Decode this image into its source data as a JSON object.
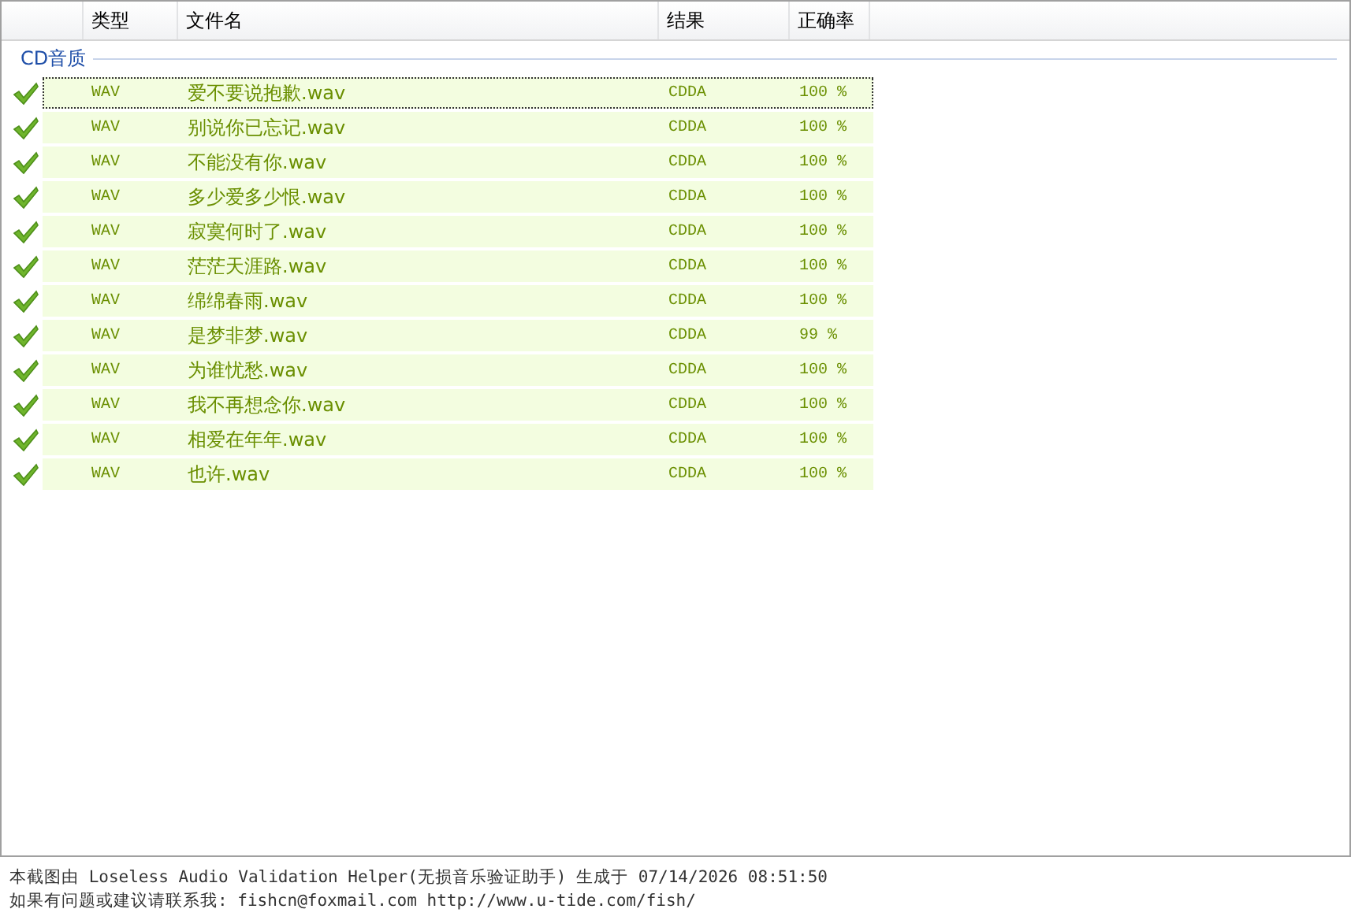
{
  "table": {
    "columns": [
      "类型",
      "文件名",
      "结果",
      "正确率"
    ],
    "group": {
      "label": "CD音质"
    },
    "rows": [
      {
        "passed": true,
        "selected": true,
        "type": "WAV",
        "file": "爱不要说抱歉.wav",
        "result": "CDDA",
        "accuracy": "100 %"
      },
      {
        "passed": true,
        "selected": false,
        "type": "WAV",
        "file": "别说你已忘记.wav",
        "result": "CDDA",
        "accuracy": "100 %"
      },
      {
        "passed": true,
        "selected": false,
        "type": "WAV",
        "file": "不能没有你.wav",
        "result": "CDDA",
        "accuracy": "100 %"
      },
      {
        "passed": true,
        "selected": false,
        "type": "WAV",
        "file": "多少爱多少恨.wav",
        "result": "CDDA",
        "accuracy": "100 %"
      },
      {
        "passed": true,
        "selected": false,
        "type": "WAV",
        "file": "寂寞何时了.wav",
        "result": "CDDA",
        "accuracy": "100 %"
      },
      {
        "passed": true,
        "selected": false,
        "type": "WAV",
        "file": "茫茫天涯路.wav",
        "result": "CDDA",
        "accuracy": "100 %"
      },
      {
        "passed": true,
        "selected": false,
        "type": "WAV",
        "file": "绵绵春雨.wav",
        "result": "CDDA",
        "accuracy": "100 %"
      },
      {
        "passed": true,
        "selected": false,
        "type": "WAV",
        "file": "是梦非梦.wav",
        "result": "CDDA",
        "accuracy": "99 %"
      },
      {
        "passed": true,
        "selected": false,
        "type": "WAV",
        "file": "为谁忧愁.wav",
        "result": "CDDA",
        "accuracy": "100 %"
      },
      {
        "passed": true,
        "selected": false,
        "type": "WAV",
        "file": "我不再想念你.wav",
        "result": "CDDA",
        "accuracy": "100 %"
      },
      {
        "passed": true,
        "selected": false,
        "type": "WAV",
        "file": "相爱在年年.wav",
        "result": "CDDA",
        "accuracy": "100 %"
      },
      {
        "passed": true,
        "selected": false,
        "type": "WAV",
        "file": "也许.wav",
        "result": "CDDA",
        "accuracy": "100 %"
      }
    ]
  },
  "footer": {
    "generated": "本截图由 Loseless Audio Validation Helper(无损音乐验证助手) 生成于 07/14/2026 08:51:50",
    "contact": "如果有问题或建议请联系我: fishcn@foxmail.com http://www.u-tide.com/fish/"
  }
}
